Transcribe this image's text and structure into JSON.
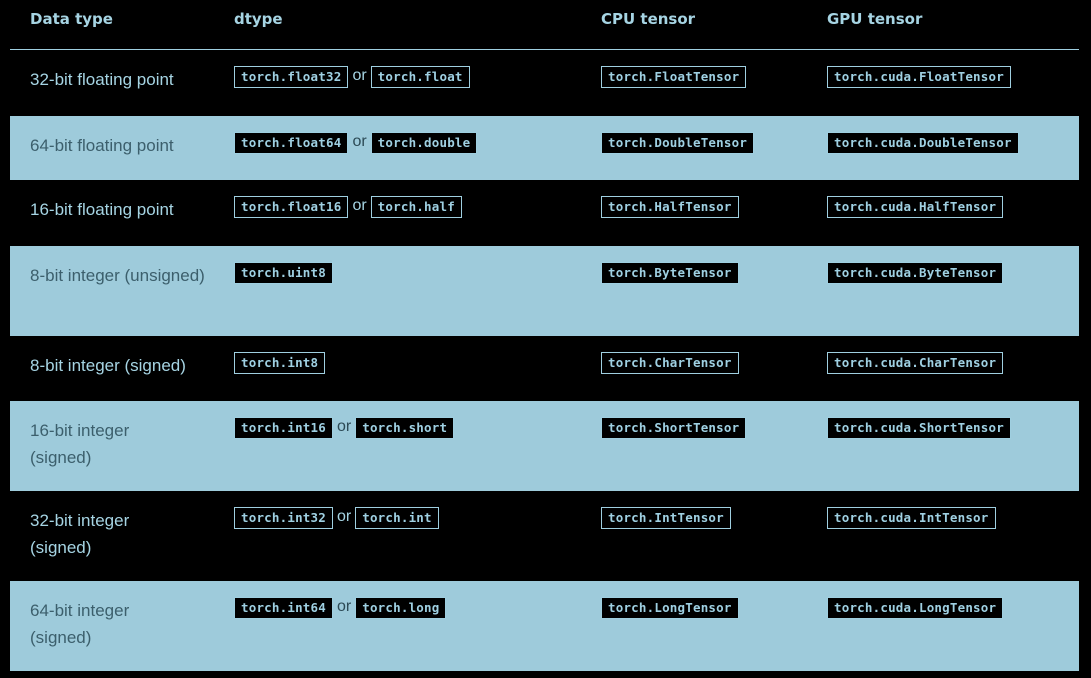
{
  "header": {
    "col1": "Data type",
    "col2": "dtype",
    "col3": "CPU tensor",
    "col4": "GPU tensor"
  },
  "rows": [
    {
      "type": "32-bit floating point",
      "dtype1": "torch.float32",
      "or": "or",
      "dtype2": "torch.float",
      "cpu": "torch.FloatTensor",
      "gpu": "torch.cuda.FloatTensor"
    },
    {
      "type": "64-bit floating point",
      "dtype1": "torch.float64",
      "or": "or",
      "dtype2": "torch.double",
      "cpu": "torch.DoubleTensor",
      "gpu": "torch.cuda.DoubleTensor"
    },
    {
      "type": "16-bit floating point",
      "dtype1": "torch.float16",
      "or": "or",
      "dtype2": "torch.half",
      "cpu": "torch.HalfTensor",
      "gpu": "torch.cuda.HalfTensor"
    },
    {
      "type": "8-bit integer (unsigned)",
      "dtype1": "torch.uint8",
      "cpu": "torch.ByteTensor",
      "gpu": "torch.cuda.ByteTensor"
    },
    {
      "type": "8-bit integer (signed)",
      "dtype1": "torch.int8",
      "cpu": "torch.CharTensor",
      "gpu": "torch.cuda.CharTensor"
    },
    {
      "type": "16-bit integer (signed)",
      "dtype1": "torch.int16",
      "or": "or",
      "dtype2": "torch.short",
      "cpu": "torch.ShortTensor",
      "gpu": "torch.cuda.ShortTensor"
    },
    {
      "type": "32-bit integer (signed)",
      "dtype1": "torch.int32",
      "or": "or",
      "dtype2": "torch.int",
      "cpu": "torch.IntTensor",
      "gpu": "torch.cuda.IntTensor"
    },
    {
      "type": "64-bit integer (signed)",
      "dtype1": "torch.int64",
      "or": "or",
      "dtype2": "torch.long",
      "cpu": "torch.LongTensor",
      "gpu": "torch.cuda.LongTensor"
    }
  ],
  "colors": {
    "background": "#000000",
    "band": "#9ecbdb",
    "accent": "#9fcfe0"
  }
}
